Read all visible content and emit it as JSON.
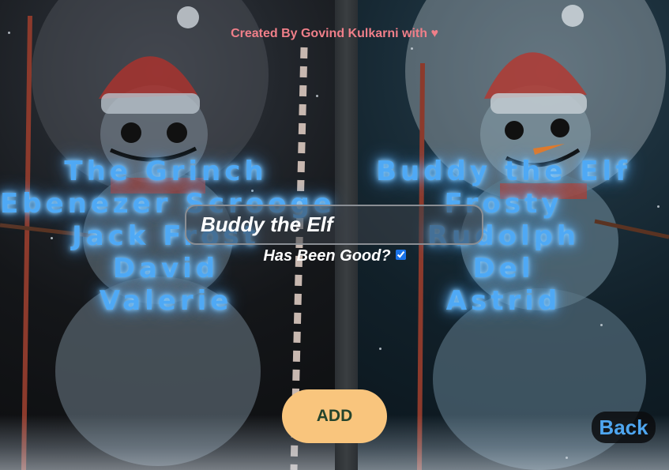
{
  "credit": "Created By Govind Kulkarni with ♥",
  "naughty_list": [
    "The Grinch",
    "Ebenezer Scrooge",
    "Jack Frost",
    "David",
    "Valerie"
  ],
  "nice_list": [
    "Buddy the Elf",
    "Frosty",
    "Rudolph",
    "Del",
    "Astrid"
  ],
  "form": {
    "name_value": "Buddy the Elf",
    "good_label": "Has Been Good?",
    "good_checked": true,
    "add_label": "ADD"
  },
  "nav": {
    "back_label": "Back"
  },
  "colors": {
    "name_glow": "#4fa9f5",
    "credit": "#f07f89",
    "add_button": "#f9c57d",
    "add_text": "#25442c",
    "back_text": "#4ea6f0"
  }
}
